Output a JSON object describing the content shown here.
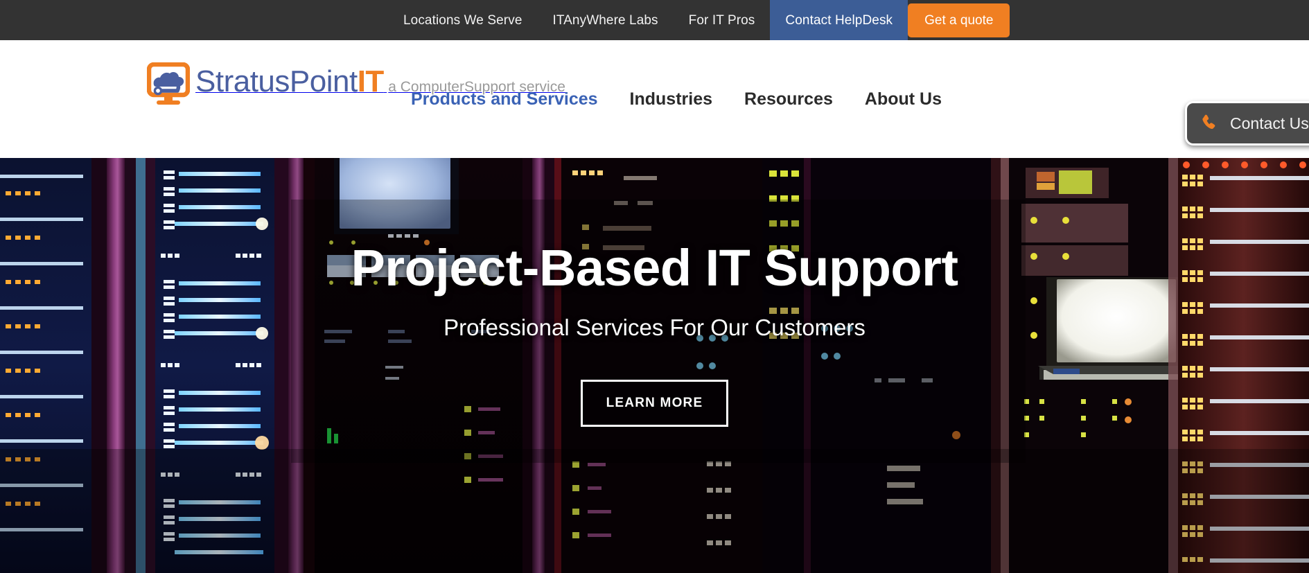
{
  "topbar": {
    "background": "#333333",
    "links": [
      {
        "label": "Locations We Serve",
        "active": false
      },
      {
        "label": "ITAnyWhere Labs",
        "active": false
      },
      {
        "label": "For IT Pros",
        "active": false
      },
      {
        "label": "Contact HelpDesk",
        "active": true
      }
    ],
    "active_color": "#3c5d96",
    "quote_button": {
      "label": "Get a quote",
      "color": "#f07f22"
    }
  },
  "header": {
    "background": "#ffffff",
    "logo": {
      "name_primary": "StratusPoint",
      "name_suffix": "IT",
      "tagline": "a ComputerSupport service",
      "primary_color": "#4a5fa0",
      "suffix_color": "#f07f22",
      "tagline_color": "#9a9a9a",
      "icon": "monitor-cloud-icon"
    },
    "nav": [
      {
        "label": "Products and Services",
        "active": true
      },
      {
        "label": "Industries",
        "active": false
      },
      {
        "label": "Resources",
        "active": false
      },
      {
        "label": "About Us",
        "active": false
      }
    ],
    "nav_active_color": "#3a62b5"
  },
  "contact_tab": {
    "label": "Contact Us",
    "icon": "phone-icon",
    "icon_color": "#f07f22",
    "background": "#4a4a4a"
  },
  "hero": {
    "title": "Project-Based IT Support",
    "subtitle": "Professional Services For Our Customers",
    "button_label": "LEARN MORE",
    "background_image": "data-center-server-racks-photo"
  }
}
